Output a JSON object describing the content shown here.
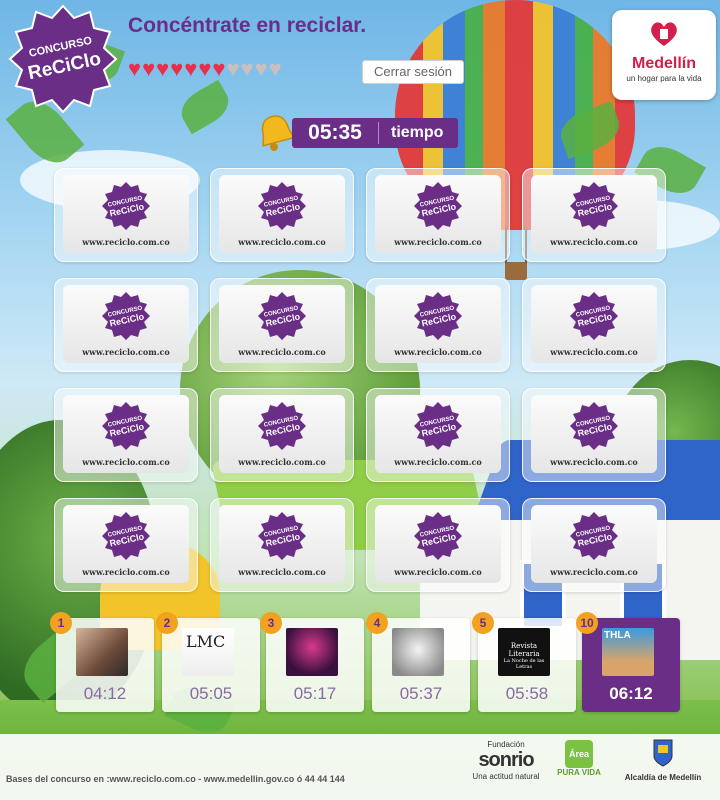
{
  "header": {
    "logo_top": "CONCURSO",
    "logo_main": "ReCiClo",
    "title": "Concéntrate en reciclar.",
    "hearts": {
      "filled": 7,
      "total": 11
    },
    "logout_label": "Cerrar sesión"
  },
  "sponsor_top": {
    "name": "Medellín",
    "tagline": "un hogar para la vida",
    "color": "#d2204a"
  },
  "timer": {
    "time": "05:35",
    "label": "tiempo"
  },
  "board": {
    "card_logo_top": "CONCURSO",
    "card_logo_main": "ReCiClo",
    "card_url": "www.reciclo.com.co",
    "rows": 4,
    "cols": 4
  },
  "found": [
    {
      "rank": "1",
      "time": "04:12",
      "image": "couple-photo"
    },
    {
      "rank": "2",
      "time": "05:05",
      "image": "lmc-magazine",
      "image_text": "LMC"
    },
    {
      "rank": "3",
      "time": "05:17",
      "image": "guitarist-photo"
    },
    {
      "rank": "4",
      "time": "05:37",
      "image": "sketch-portrait"
    },
    {
      "rank": "5",
      "time": "05:58",
      "image": "revista-literaria",
      "image_text": "Revista Literaria",
      "image_sub": "La Noche de las Letras"
    },
    {
      "rank": "10",
      "time": "06:12",
      "image": "thla-photo",
      "image_text": "THLA",
      "highlight": true
    }
  ],
  "footer": {
    "text": "Bases del concurso en :www.reciclo.com.co - www.medellin.gov.co ó 44 44 144",
    "sponsors": {
      "fundacion": "Fundación",
      "sonrio": "sonrio",
      "sonrio_tag": "Una actitud natural",
      "area": "Área",
      "pura_vida": "PURA VIDA",
      "alcaldia": "Alcaldía de Medellín"
    }
  },
  "colors": {
    "brand_purple": "#6a2e86",
    "heart_on": "#e8304a",
    "heart_off": "#c9bfbf",
    "badge_orange": "#f2a21e"
  }
}
